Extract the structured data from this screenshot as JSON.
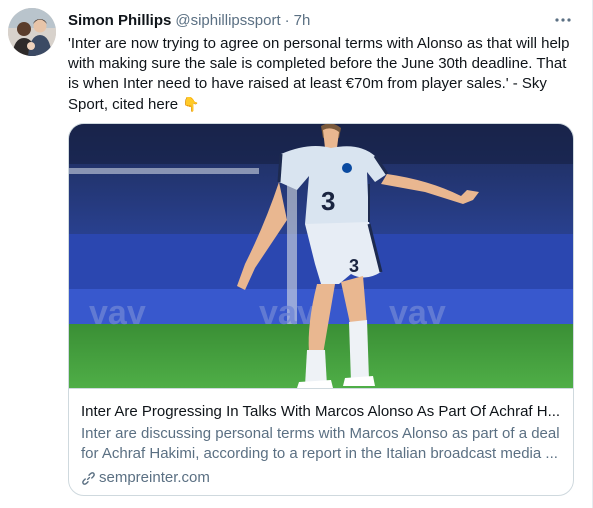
{
  "tweet": {
    "display_name": "Simon Phillips",
    "handle": "@siphillipssport",
    "separator": "·",
    "time": "7h",
    "text": "'Inter are now trying to agree on personal terms with Alonso as that will help with making sure the sale is completed before the June 30th deadline. That is when Inter need to have raised at least €70m from player sales.' - Sky Sport, cited here",
    "emoji": "👇",
    "avatar_icon": "profile-photo",
    "more_icon": "more-dots-icon"
  },
  "card": {
    "title": "Inter Are Progressing In Talks With Marcos Alonso As Part Of Achraf H...",
    "description": "Inter are discussing personal terms with Marcos Alonso as part of a deal for Achraf Hakimi, according to a report in the Italian broadcast media ...",
    "domain": "sempreinter.com",
    "domain_icon": "link-icon",
    "image_shirt_number": "3"
  },
  "colors": {
    "text": "#0f1419",
    "muted": "#5b7083",
    "border": "#cfd9de",
    "pitch": "#3f9b3a",
    "stands": "#2b3e9c"
  }
}
